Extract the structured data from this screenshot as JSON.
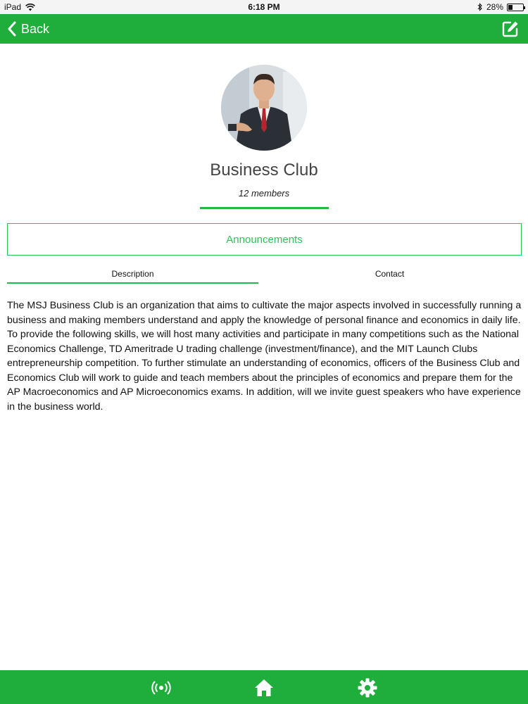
{
  "status_bar": {
    "carrier": "iPad",
    "time": "6:18 PM",
    "battery": "28%",
    "battery_level": 0.28
  },
  "nav": {
    "back_label": "Back",
    "back_icon": "chevron-left-icon",
    "edit_icon": "edit-icon"
  },
  "club": {
    "name": "Business Club",
    "members": "12 members"
  },
  "announcements_label": "Announcements",
  "tabs": [
    {
      "label": "Description",
      "active": true
    },
    {
      "label": "Contact",
      "active": false
    }
  ],
  "description": "The MSJ Business Club is an organization that aims to cultivate the major aspects involved in successfully running a business and making members understand and apply the knowledge of personal finance and economics in daily life. To provide the following skills, we will host many activities and participate in many competitions such as the National Economics Challenge, TD Ameritrade U trading challenge (investment/finance), and the MIT Launch Clubs entrepreneurship competition. To further stimulate an understanding of economics, officers of the Business Club and Economics Club will work to guide and teach members about the principles of economics and prepare them for the AP Macroeconomics and AP Microeconomics exams. In addition, will we invite guest speakers who have experience in the business world.",
  "tab_bar": [
    {
      "icon": "broadcast-icon"
    },
    {
      "icon": "home-icon"
    },
    {
      "icon": "gear-icon"
    }
  ],
  "colors": {
    "brand_green": "#1fae3c",
    "accent_green": "#2fc25a"
  }
}
